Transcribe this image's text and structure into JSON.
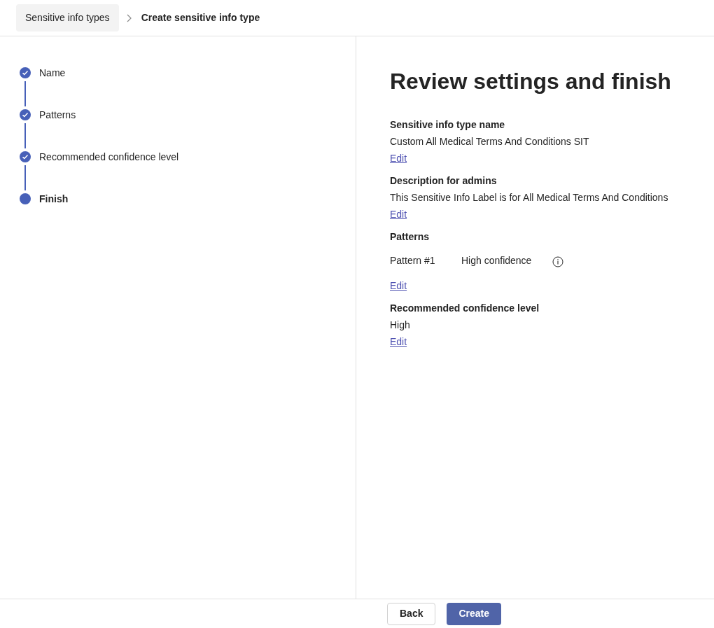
{
  "breadcrumb": [
    {
      "label": "Sensitive info types",
      "current": false
    },
    {
      "label": "Create sensitive info type",
      "current": true
    }
  ],
  "steps": [
    {
      "label": "Name",
      "completed": true,
      "selected": false
    },
    {
      "label": "Patterns",
      "completed": true,
      "selected": false
    },
    {
      "label": "Recommended confidence level",
      "completed": true,
      "selected": false
    },
    {
      "label": "Finish",
      "completed": false,
      "selected": true
    }
  ],
  "title": "Review settings and finish",
  "sections": [
    {
      "kind": "text",
      "heading": "Sensitive info type name",
      "value": "Custom All Medical Terms And Conditions SIT",
      "link": "Edit"
    },
    {
      "kind": "text",
      "heading": "Description for admins",
      "value": "This Sensitive Info Label is for All Medical Terms And Conditions",
      "link": "Edit"
    },
    {
      "kind": "patterns",
      "heading": "Patterns",
      "patterns": [
        {
          "name": "Pattern #1",
          "confidence": "High confidence"
        }
      ],
      "link": "Edit"
    },
    {
      "kind": "text",
      "heading": "Recommended confidence level",
      "value": "High",
      "link": "Edit"
    }
  ],
  "buttons": [
    {
      "label": "Back",
      "kind": "secondary"
    },
    {
      "label": "Create",
      "kind": "primary"
    }
  ]
}
